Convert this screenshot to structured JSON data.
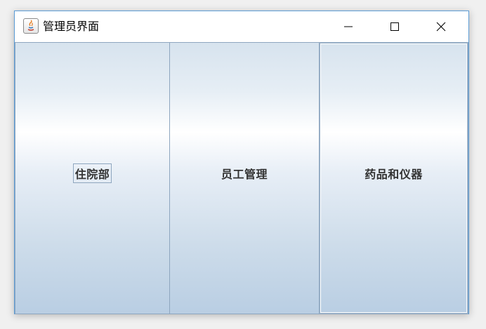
{
  "window": {
    "title": "管理员界面",
    "controls": {
      "minimize_icon": "minimize-icon",
      "maximize_icon": "maximize-icon",
      "close_icon": "close-icon"
    }
  },
  "buttons": [
    {
      "label": "住院部",
      "focused": true
    },
    {
      "label": "员工管理",
      "focused": false
    },
    {
      "label": "药品和仪器",
      "focused": false
    }
  ],
  "colors": {
    "window_border": "#5b9bd5",
    "button_border": "#8ea6bf",
    "button_gradient_top": "#d7e3ee",
    "button_gradient_highlight": "#ffffff",
    "button_gradient_bottom": "#b9cee3",
    "label_text": "#333333"
  }
}
